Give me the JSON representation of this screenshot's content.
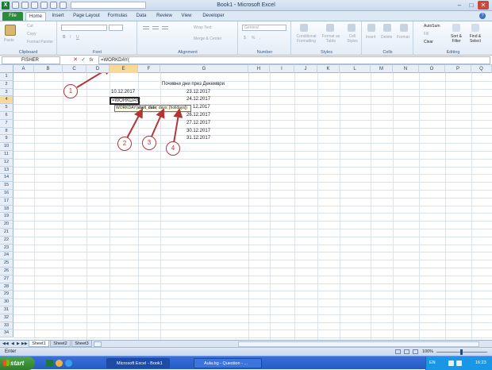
{
  "window": {
    "title": "Book1 - Microsoft Excel",
    "min": "–",
    "max": "□",
    "close": "✕"
  },
  "ribbon_tabs": [
    "File",
    "Home",
    "Insert",
    "Page Layout",
    "Formulas",
    "Data",
    "Review",
    "View",
    "Developer"
  ],
  "clipboard": {
    "paste": "Paste",
    "cut": "Cut",
    "copy": "Copy",
    "format_painter": "Format Painter",
    "label": "Clipboard"
  },
  "font": {
    "label": "Font",
    "bold": "B",
    "italic": "I",
    "underline": "U"
  },
  "alignment": {
    "wrap_text": "Wrap Text",
    "merge": "Merge & Center",
    "label": "Alignment"
  },
  "number": {
    "format": "General",
    "label": "Number",
    "currency": "$",
    "percent": "%",
    "comma": ","
  },
  "styles": {
    "conditional": "Conditional Formatting",
    "format_table": "Format as Table",
    "cell_styles": "Cell Styles",
    "label": "Styles"
  },
  "cells": {
    "insert": "Insert",
    "delete": "Delete",
    "format": "Format",
    "label": "Cells"
  },
  "editing": {
    "autosum": "AutoSum",
    "fill": "Fill",
    "clear": "Clear",
    "sort": "Sort & Filter",
    "find": "Find & Select",
    "label": "Editing"
  },
  "formula_bar": {
    "name_box": "FISHER",
    "formula": "=WORKDAY(",
    "cancel": "✕",
    "enter": "✓",
    "fx": "fx"
  },
  "columns": [
    "A",
    "B",
    "C",
    "D",
    "E",
    "F",
    "G",
    "H",
    "I",
    "J",
    "K",
    "L",
    "M",
    "N",
    "O",
    "P",
    "Q"
  ],
  "rows": [
    "1",
    "2",
    "3",
    "4",
    "5",
    "6",
    "7",
    "8",
    "9",
    "10",
    "11",
    "12",
    "13",
    "14",
    "15",
    "16",
    "17",
    "18",
    "19",
    "20",
    "21",
    "22",
    "23",
    "24",
    "25",
    "26",
    "27",
    "28",
    "29",
    "30",
    "31",
    "32",
    "33",
    "34"
  ],
  "cells_data": {
    "d3": "10.12.2017",
    "g2": "Почивни дни през Декември",
    "g3": "23.12.2017",
    "g4": "24.12.2017",
    "g5": "12.2017",
    "g6": "26.12.2017",
    "g7": "27.12.2017",
    "g8": "30.12.2017",
    "g9": "31.12.2017"
  },
  "active_cell": {
    "text": "=WORKDAY("
  },
  "tooltip": {
    "fn": "WORKDAY(",
    "arg1": "start_date",
    "rest": "; days; [holidays])"
  },
  "callouts": [
    "1",
    "2",
    "3",
    "4"
  ],
  "sheets": [
    "Sheet1",
    "Sheet2",
    "Sheet3"
  ],
  "status": {
    "mode": "Enter",
    "zoom": "100%"
  },
  "taskbar": {
    "start": "start",
    "tasks": [
      "Microsoft Excel - Book1",
      "Aula.bg - Question - ..."
    ],
    "lang": "EN",
    "time": "16:23"
  }
}
